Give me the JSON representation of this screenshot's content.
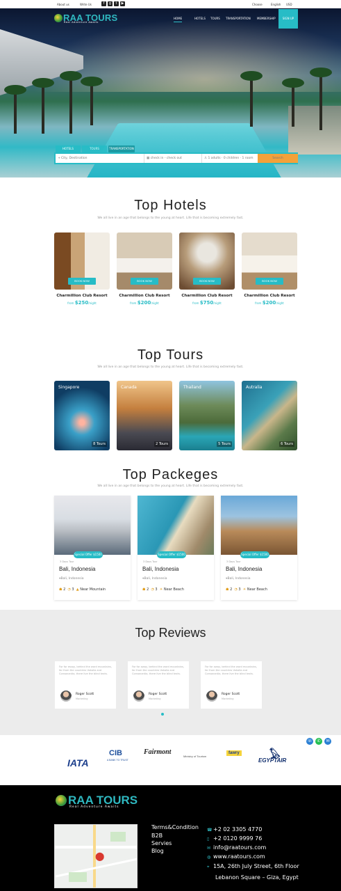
{
  "topbar": {
    "contact": "About us",
    "email": "Write Us",
    "currency": "Choose",
    "language": "English",
    "extra": "USD"
  },
  "brand": {
    "name": "RAA TOURS",
    "tagline": "Real Adventure Awaits"
  },
  "nav": {
    "home": "HOME",
    "hotels": "HOTELS",
    "tours": "TOURS",
    "transportation": "TRANSPORTATION",
    "membership": "MEMBERSHIP",
    "signup": "SIGN UP"
  },
  "search": {
    "tabs": [
      "HOTELS",
      "TOURS",
      "TRANSPORTATION"
    ],
    "city_placeholder": "City, Destination",
    "dates_placeholder": "check in - check out",
    "guests": "1 adults · 0 children · 1 room",
    "button": "Search"
  },
  "hotels": {
    "title": "Top Hotels",
    "subtitle": "We all live in an age that belongs to the young at heart. Life that is becoming extremely fast.",
    "items": [
      {
        "name": "Charmillion Club Resort",
        "from": "from",
        "price": "$250",
        "per": "/night",
        "cta": "BOOK NOW"
      },
      {
        "name": "Charmillion Club Resort",
        "from": "from",
        "price": "$200",
        "per": "/night",
        "cta": "BOOK NOW"
      },
      {
        "name": "Charmillion Club Resort",
        "from": "from",
        "price": "$750",
        "per": "/night",
        "cta": "BOOK NOW"
      },
      {
        "name": "Charmillion Club Resort",
        "from": "from",
        "price": "$200",
        "per": "/night",
        "cta": "BOOK NOW"
      }
    ]
  },
  "tours": {
    "title": "Top Tours",
    "subtitle": "We all live in an age that belongs to the young at heart. Life that is becoming extremely fast.",
    "items": [
      {
        "name": "Singapore",
        "count": "8 Tours"
      },
      {
        "name": "Canada",
        "count": "2 Tours"
      },
      {
        "name": "Thailand",
        "count": "5 Tours"
      },
      {
        "name": "Autralia",
        "count": "6 Tours"
      }
    ]
  },
  "packages": {
    "title": "Top Packeges",
    "subtitle": "We all live in an age that belongs to the young at heart. Life that is becoming extremely fast.",
    "items": [
      {
        "badge": "Special Offer $1500",
        "days": "3 Days Tour",
        "title": "Bali, Indonesia",
        "location": "Bali, Indonesia",
        "a": "2",
        "b": "3",
        "place": "Near Mountain"
      },
      {
        "badge": "Special Offer $1500",
        "days": "3 Days Tour",
        "title": "Bali, Indonesia",
        "location": "Bali, Indonesia",
        "a": "2",
        "b": "3",
        "place": "Near Beach"
      },
      {
        "badge": "Special Offer $1500",
        "days": "3 Days Tour",
        "title": "Bali, Indonesia",
        "location": "Bali, Indonesia",
        "a": "2",
        "b": "3",
        "place": "Near Beach"
      }
    ]
  },
  "reviews": {
    "title": "Top Reviews",
    "items": [
      {
        "text": "For for essay, behind the word mountains, far from the countries Vokalia and Consonantia, there live the blind texts.",
        "name": "Roger Scott",
        "role": "Marketing"
      },
      {
        "text": "Far far away, behind the word mountains, far from the countries Vokalia and Consonantia, there live the blind texts.",
        "name": "Roger Scott",
        "role": "Marketing"
      },
      {
        "text": "Far far away, behind the word mountains, far from the countries Vokalia and Consonantia, there live the blind texts.",
        "name": "Roger Scott",
        "role": "Marketing"
      }
    ]
  },
  "partners": {
    "iata": "IATA",
    "cib": "CIB",
    "cib_sub": "A BANK TO TRUST",
    "fairmont": "Fairmont",
    "ministry": "Ministry of Tourism",
    "fawry": "fawry",
    "egyptair": "EGYPTAIR"
  },
  "footer": {
    "links": [
      "Terms&Condition",
      "B2B",
      "Servies",
      "Blog"
    ],
    "phone1": "+2 02 3305 4770",
    "phone2": "+2 0120 9999 76",
    "email": "info@raatours.com",
    "website": "www.raatours.com",
    "address1": "15A, 26th July Street, 6th Floor",
    "address2": "Lebanon Square – Giza, Egypt"
  },
  "colors": {
    "accent": "#27bcc6",
    "search_button": "#f3a13a",
    "footer_bg": "#000000"
  }
}
